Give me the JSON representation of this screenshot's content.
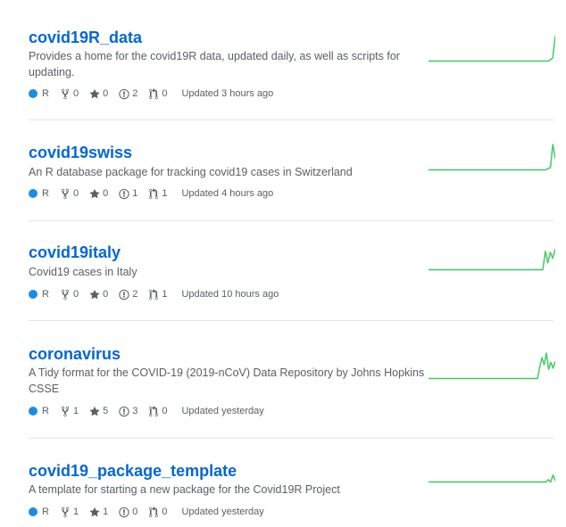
{
  "colors": {
    "link": "#0366d6",
    "language_r": "#198ce7",
    "sparkline_fill": "#9be9a8",
    "sparkline_stroke": "#40c463",
    "muted": "#586069",
    "divider": "#e1e4e8"
  },
  "icons": {
    "forks": "repo-forked-icon",
    "stars": "star-icon",
    "issues": "issue-opened-icon",
    "pull_requests": "git-pull-request-icon"
  },
  "repos": [
    {
      "name": "covid19R_data",
      "description": "Provides a home for the covid19R data, updated daily, as well as scripts for updating.",
      "language": "R",
      "forks": "0",
      "stars": "0",
      "issues": "2",
      "pull_requests": "0",
      "updated": "Updated 3 hours ago",
      "activity": [
        0,
        0,
        0,
        0,
        0,
        0,
        0,
        0,
        0,
        0,
        0,
        0,
        0,
        0,
        0,
        0,
        0,
        0,
        0,
        0,
        0,
        0,
        0,
        0,
        0,
        0,
        0,
        0,
        0,
        0,
        0,
        0,
        0,
        0,
        0,
        0,
        0,
        0,
        0,
        0,
        0,
        0,
        0,
        0,
        0,
        0,
        0,
        0,
        0,
        1,
        3,
        22
      ]
    },
    {
      "name": "covid19swiss",
      "description": "An R database package for tracking covid19 cases in Switzerland",
      "language": "R",
      "forks": "0",
      "stars": "0",
      "issues": "1",
      "pull_requests": "1",
      "updated": "Updated 4 hours ago",
      "activity": [
        0,
        0,
        0,
        0,
        0,
        0,
        0,
        0,
        0,
        0,
        0,
        0,
        0,
        0,
        0,
        0,
        0,
        0,
        0,
        0,
        0,
        0,
        0,
        0,
        0,
        0,
        0,
        0,
        0,
        0,
        0,
        0,
        0,
        0,
        0,
        0,
        0,
        0,
        0,
        0,
        0,
        0,
        0,
        0,
        0,
        0,
        0,
        0,
        0,
        1,
        2,
        22,
        10
      ]
    },
    {
      "name": "covid19italy",
      "description": "Covid19 cases in Italy",
      "language": "R",
      "forks": "0",
      "stars": "0",
      "issues": "2",
      "pull_requests": "1",
      "updated": "Updated 10 hours ago",
      "activity": [
        0,
        0,
        0,
        0,
        0,
        0,
        0,
        0,
        0,
        0,
        0,
        0,
        0,
        0,
        0,
        0,
        0,
        0,
        0,
        0,
        0,
        0,
        0,
        0,
        0,
        0,
        0,
        0,
        0,
        0,
        0,
        0,
        0,
        0,
        0,
        0,
        0,
        0,
        0,
        0,
        0,
        0,
        0,
        0,
        0,
        0,
        0,
        16,
        6,
        15,
        10,
        18
      ]
    },
    {
      "name": "coronavirus",
      "description": "A Tidy format for the COVID-19 (2019-nCoV) Data Repository by Johns Hopkins CSSE",
      "language": "R",
      "forks": "1",
      "stars": "5",
      "issues": "3",
      "pull_requests": "0",
      "updated": "Updated yesterday",
      "activity": [
        0,
        0,
        0,
        0,
        0,
        0,
        0,
        0,
        0,
        0,
        0,
        0,
        0,
        0,
        0,
        0,
        0,
        0,
        0,
        0,
        0,
        0,
        0,
        0,
        0,
        0,
        0,
        0,
        0,
        0,
        0,
        0,
        0,
        0,
        0,
        0,
        0,
        0,
        0,
        0,
        0,
        0,
        0,
        0,
        0,
        0,
        0,
        0,
        0,
        0,
        10,
        18,
        12,
        22,
        8,
        14,
        9,
        15
      ]
    },
    {
      "name": "covid19_package_template",
      "description": "A template for starting a new package for the Covid19R Project",
      "language": "R",
      "forks": "1",
      "stars": "1",
      "issues": "0",
      "pull_requests": "0",
      "updated": "Updated yesterday",
      "activity": [
        0,
        0,
        0,
        0,
        0,
        0,
        0,
        0,
        0,
        0,
        0,
        0,
        0,
        0,
        0,
        0,
        0,
        0,
        0,
        0,
        0,
        0,
        0,
        0,
        0,
        0,
        0,
        0,
        0,
        0,
        0,
        0,
        0,
        0,
        0,
        0,
        0,
        0,
        0,
        0,
        0,
        0,
        0,
        0,
        0,
        0,
        0,
        0,
        0,
        0,
        0,
        0,
        2,
        0,
        6,
        1
      ]
    }
  ]
}
